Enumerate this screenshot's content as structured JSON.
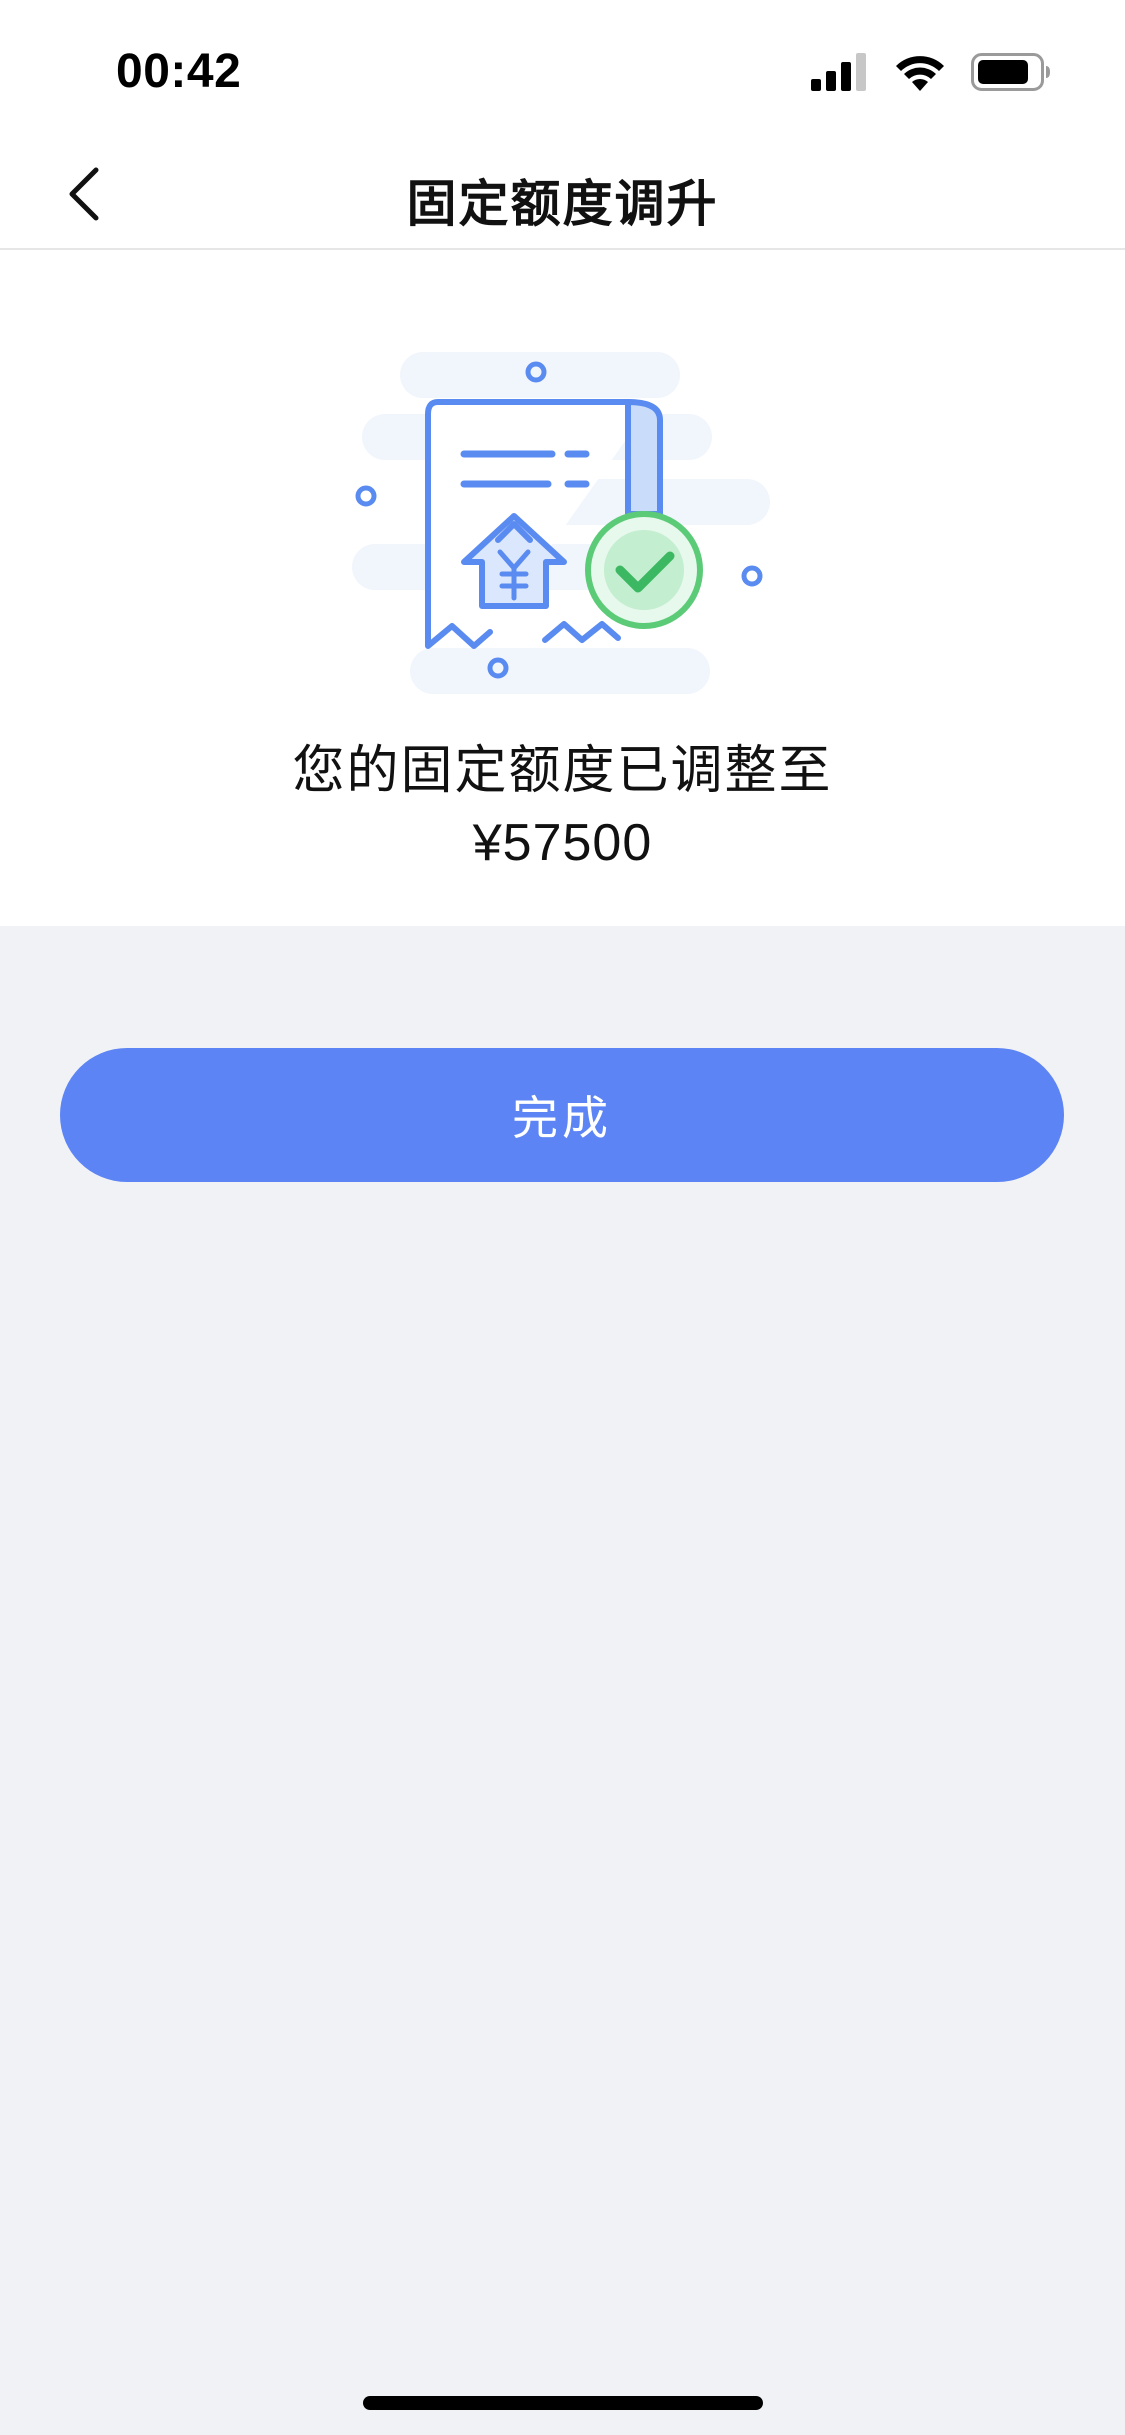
{
  "status_bar": {
    "time": "00:42",
    "icons": [
      "cellular-signal-icon",
      "wifi-icon",
      "battery-icon"
    ]
  },
  "nav": {
    "title": "固定额度调升",
    "back_icon": "chevron-left-icon"
  },
  "result": {
    "illustration_icons": [
      "receipt-icon",
      "yuan-house-icon",
      "checkmark-badge-icon"
    ],
    "message": "您的固定额度已调整至",
    "amount": "¥57500"
  },
  "actions": {
    "done_label": "完成"
  },
  "colors": {
    "primary": "#5c84f4",
    "success": "#5ccb78",
    "page_background": "#f0f2f6",
    "card_background": "#ffffff"
  }
}
